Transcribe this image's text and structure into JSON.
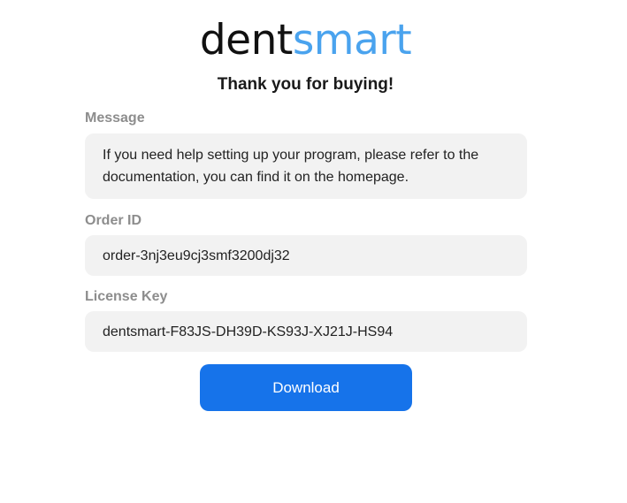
{
  "brand": {
    "logo_part1": "dent",
    "logo_part2": "smart",
    "accent_color": "#4aa3ee"
  },
  "title": "Thank you for buying!",
  "fields": {
    "message": {
      "label": "Message",
      "value": "If you need help setting up your program, please refer to the documentation, you can find it on the homepage."
    },
    "order_id": {
      "label": "Order ID",
      "value": "order-3nj3eu9cj3smf3200dj32"
    },
    "license_key": {
      "label": "License Key",
      "value": "dentsmart-F83JS-DH39D-KS93J-XJ21J-HS94"
    }
  },
  "actions": {
    "download_label": "Download",
    "button_color": "#1673ea"
  }
}
